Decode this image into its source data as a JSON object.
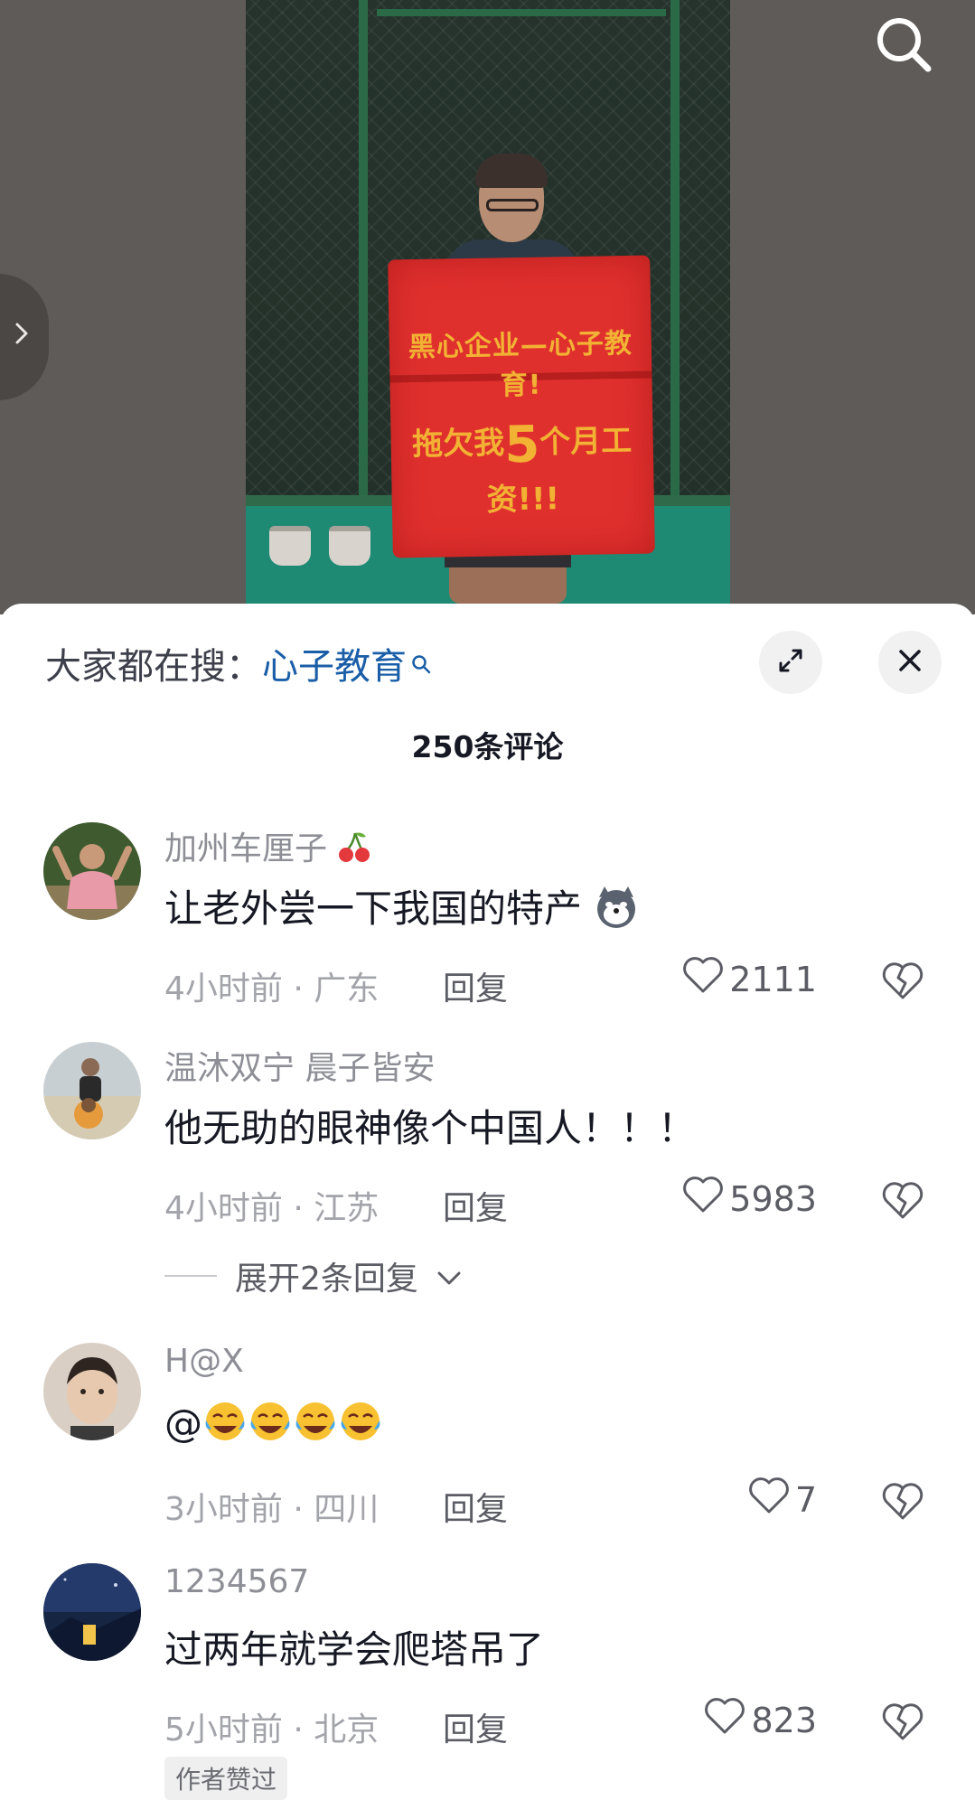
{
  "search": {
    "trend_prefix": "大家都在搜：",
    "trend_keyword": "心子教育"
  },
  "video": {
    "banner_line1": "黑心企业—心子教育!",
    "banner_line2_pre": "拖欠我",
    "banner_line2_num": "5",
    "banner_line2_post": "个月工资!!!"
  },
  "sheet": {
    "comment_count": "250条评论"
  },
  "comments": [
    {
      "author": "加州车厘子",
      "text": "让老外尝一下我国的特产",
      "time": "4小时前",
      "location": "广东",
      "reply_label": "回复",
      "likes": "2111"
    },
    {
      "author": "温沐双宁 晨子皆安",
      "text": "他无助的眼神像个中国人！！！",
      "time": "4小时前",
      "location": "江苏",
      "reply_label": "回复",
      "likes": "5983",
      "expand_replies": "展开2条回复"
    },
    {
      "author": "H@X",
      "text": "@",
      "time": "3小时前",
      "location": "四川",
      "reply_label": "回复",
      "likes": "7"
    },
    {
      "author": "1234567",
      "text": "过两年就学会爬塔吊了",
      "time": "5小时前",
      "location": "北京",
      "reply_label": "回复",
      "likes": "823",
      "badge": "作者赞过"
    }
  ],
  "meta_separator": " · ",
  "colors": {
    "link": "#1a5ea8",
    "banner": "#e0302e",
    "banner_text": "#f2b233"
  }
}
